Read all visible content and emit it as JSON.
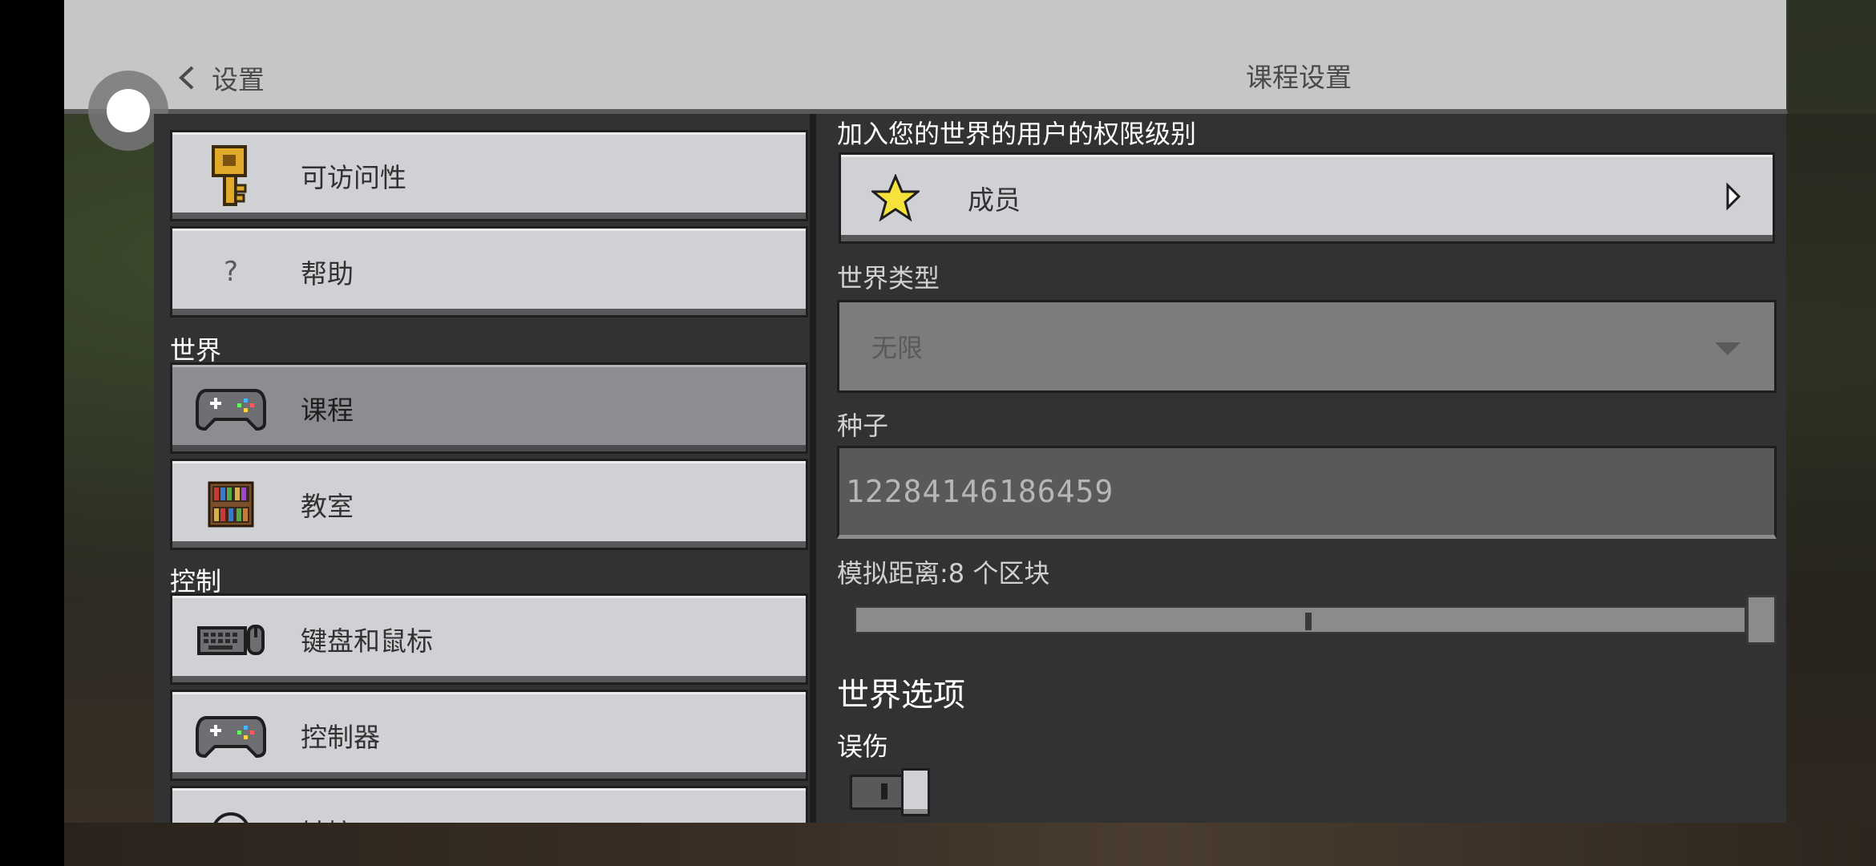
{
  "header": {
    "back_label": "设置",
    "title": "课程设置"
  },
  "sidebar": {
    "sections": {
      "world": "世界",
      "controls": "控制"
    },
    "items": [
      {
        "label": "可访问性",
        "icon": "key-icon"
      },
      {
        "label": "帮助",
        "icon": "question-icon"
      },
      {
        "label": "课程",
        "icon": "controller-icon",
        "active": true
      },
      {
        "label": "教室",
        "icon": "bookshelf-icon"
      },
      {
        "label": "键盘和鼠标",
        "icon": "keyboard-mouse-icon"
      },
      {
        "label": "控制器",
        "icon": "controller-icon"
      },
      {
        "label": "触控",
        "icon": "touch-icon"
      }
    ]
  },
  "settings": {
    "permission_label": "加入您的世界的用户的权限级别",
    "permission_value": "成员",
    "world_type_label": "世界类型",
    "world_type_value": "无限",
    "seed_label": "种子",
    "seed_value": "12284146186459",
    "sim_distance_label": "模拟距离:8 个区块",
    "sim_distance_value": 8,
    "world_options_heading": "世界选项",
    "friendly_fire_label": "误伤",
    "friendly_fire_on": false
  },
  "colors": {
    "panel": "#313233",
    "button": "#d0d1d4",
    "button_active": "#8c8d90",
    "header": "#c6c6c6"
  }
}
